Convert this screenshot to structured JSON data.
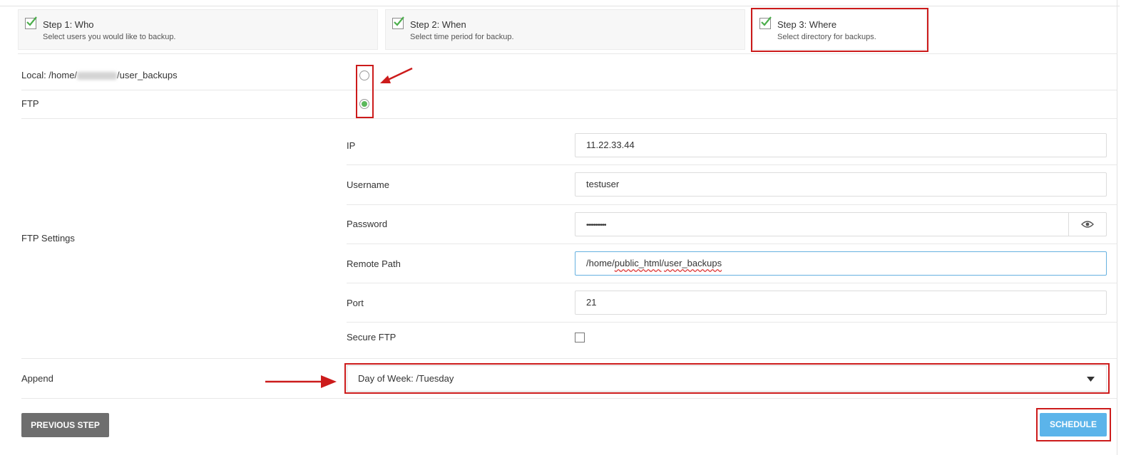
{
  "steps": [
    {
      "title": "Step 1: Who",
      "desc": "Select users you would like to backup."
    },
    {
      "title": "Step 2: When",
      "desc": "Select time period for backup."
    },
    {
      "title": "Step 3: Where",
      "desc": "Select directory for backups."
    }
  ],
  "destination": {
    "local_label_prefix": "Local: /home/",
    "local_label_suffix": "/user_backups",
    "ftp_label": "FTP",
    "selected": "FTP"
  },
  "ftp_settings": {
    "section_label": "FTP Settings",
    "fields": {
      "ip": {
        "label": "IP",
        "value": "11.22.33.44"
      },
      "username": {
        "label": "Username",
        "value": "testuser"
      },
      "password": {
        "label": "Password",
        "value": "•••••••••••"
      },
      "remote_path": {
        "label": "Remote Path",
        "value_a": "/home/",
        "value_b": "public_html",
        "value_c": "/",
        "value_d": "user_backups"
      },
      "port": {
        "label": "Port",
        "value": "21"
      },
      "secure": {
        "label": "Secure FTP",
        "checked": false
      }
    }
  },
  "append": {
    "label": "Append",
    "value": "Day of Week: /Tuesday"
  },
  "buttons": {
    "previous": "PREVIOUS STEP",
    "schedule": "SCHEDULE"
  },
  "colors": {
    "highlight": "#cc1b1b",
    "check": "#5cb85c",
    "schedule": "#5bb4ea",
    "previous": "#6e6e6e"
  }
}
